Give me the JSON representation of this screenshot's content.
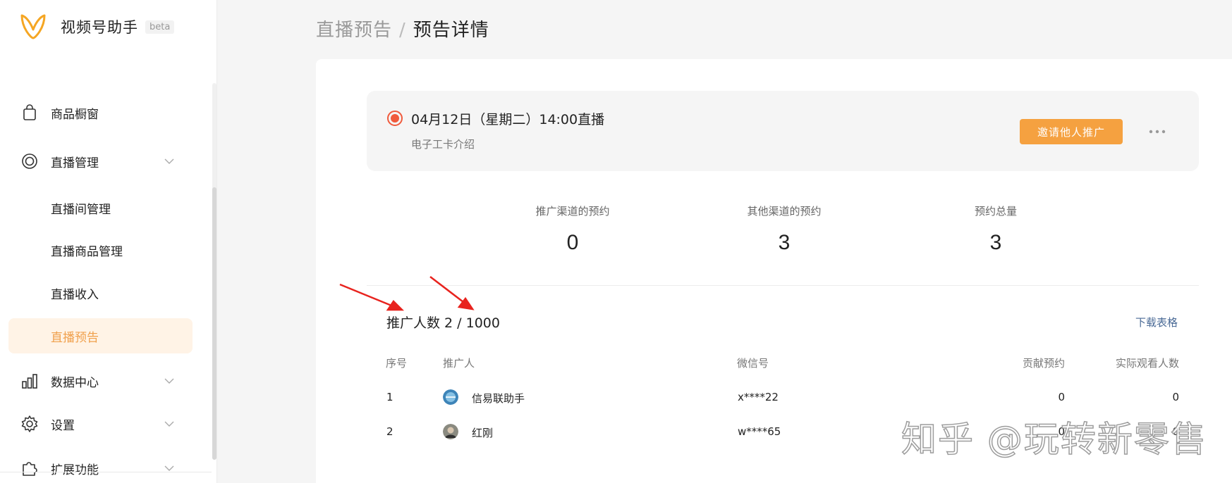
{
  "brand": {
    "name": "视频号助手",
    "badge": "beta"
  },
  "sidebar": {
    "items": [
      {
        "label": "商品橱窗",
        "icon": "shopping-bag-icon"
      },
      {
        "label": "直播管理",
        "icon": "live-circle-icon"
      },
      {
        "label": "直播间管理"
      },
      {
        "label": "直播商品管理"
      },
      {
        "label": "直播收入"
      },
      {
        "label": "直播预告",
        "active": true
      },
      {
        "label": "数据中心",
        "icon": "bar-chart-icon"
      },
      {
        "label": "设置",
        "icon": "gear-icon"
      },
      {
        "label": "扩展功能",
        "icon": "puzzle-icon"
      }
    ]
  },
  "breadcrumb": {
    "parent": "直播预告",
    "separator": "/",
    "current": "预告详情"
  },
  "live": {
    "title": "04月12日（星期二）14:00直播",
    "subtitle": "电子工卡介绍",
    "invite_label": "邀请他人推广"
  },
  "stats": [
    {
      "label": "推广渠道的预约",
      "value": "0"
    },
    {
      "label": "其他渠道的预约",
      "value": "3"
    },
    {
      "label": "预约总量",
      "value": "3"
    }
  ],
  "promoters": {
    "count_text": "推广人数 2 / 1000",
    "download_label": "下载表格",
    "columns": [
      "序号",
      "推广人",
      "微信号",
      "贡献预约",
      "实际观看人数"
    ],
    "rows": [
      {
        "index": "1",
        "name": "信易联助手",
        "wechat": "x****22",
        "reservations": "0",
        "viewers": "0"
      },
      {
        "index": "2",
        "name": "红刚",
        "wechat": "w****65",
        "reservations": "0",
        "viewers": "0"
      }
    ]
  },
  "watermark": "知乎 @玩转新零售",
  "colors": {
    "accent": "#f5a140",
    "active_bg": "#fff3e6",
    "live_red": "#f05a3c",
    "annotation_arrow": "#e8231e"
  }
}
